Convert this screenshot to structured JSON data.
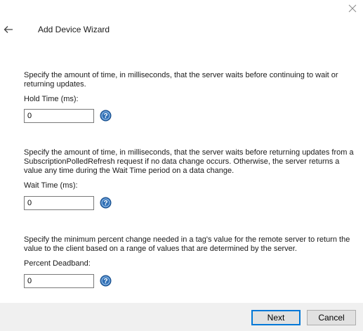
{
  "wizard": {
    "title": "Add Device Wizard"
  },
  "sections": [
    {
      "description": "Specify the amount of time, in milliseconds, that the server waits before continuing to wait or returning updates.",
      "label": "Hold Time (ms):",
      "value": "0"
    },
    {
      "description": "Specify the amount of time, in milliseconds, that the server waits before returning updates from a SubscriptionPolledRefresh request if no data change occurs. Otherwise, the server returns a value any time during the Wait Time period on a data change.",
      "label": "Wait Time (ms):",
      "value": "0"
    },
    {
      "description": "Specify the minimum percent change needed in a tag's value for the remote server to return the value to the client based on a range of values that are determined by the server.",
      "label": "Percent Deadband:",
      "value": "0"
    }
  ],
  "footer": {
    "next_label": "Next",
    "cancel_label": "Cancel"
  },
  "icons": {
    "close": "close-icon",
    "back": "back-arrow-icon",
    "help": "help-icon"
  },
  "colors": {
    "help_icon": "#2f6fb5",
    "primary_border": "#0078d7",
    "footer_bg": "#f0f0f0"
  }
}
